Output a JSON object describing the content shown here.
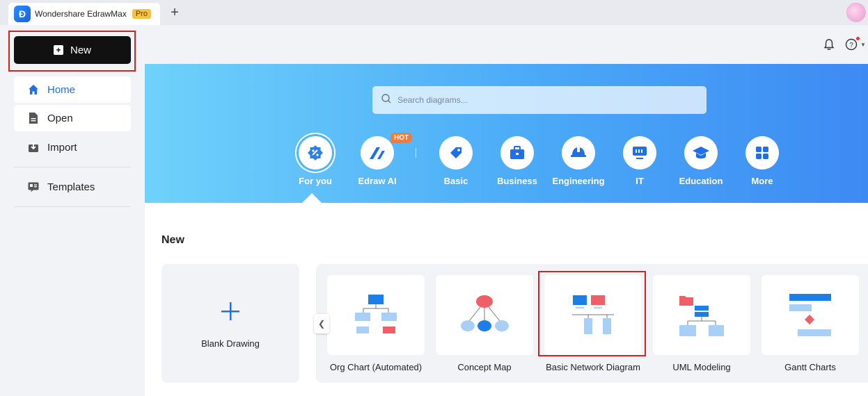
{
  "titlebar": {
    "app_title": "Wondershare EdrawMax",
    "badge": "Pro",
    "logo_glyph": "Đ",
    "add_tab": "+"
  },
  "sidebar": {
    "new_label": "New",
    "items": [
      {
        "label": "Home",
        "icon": "home-icon"
      },
      {
        "label": "Open",
        "icon": "file-icon"
      },
      {
        "label": "Import",
        "icon": "import-icon"
      },
      {
        "label": "Templates",
        "icon": "templates-icon"
      }
    ]
  },
  "search": {
    "placeholder": "Search diagrams..."
  },
  "categories": [
    {
      "label": "For you",
      "icon": "for-you-icon",
      "active": true
    },
    {
      "label": "Edraw AI",
      "icon": "edraw-ai-icon",
      "badge": "HOT"
    },
    {
      "label": "Basic",
      "icon": "basic-tag-icon"
    },
    {
      "label": "Business",
      "icon": "briefcase-icon"
    },
    {
      "label": "Engineering",
      "icon": "hardhat-icon"
    },
    {
      "label": "IT",
      "icon": "monitor-icon"
    },
    {
      "label": "Education",
      "icon": "graduation-cap-icon"
    },
    {
      "label": "More",
      "icon": "grid-icon"
    }
  ],
  "main": {
    "section_title": "New",
    "blank_label": "Blank Drawing",
    "templates": [
      {
        "label": "Org Chart (Automated)"
      },
      {
        "label": "Concept Map"
      },
      {
        "label": "Basic Network Diagram",
        "selected": true
      },
      {
        "label": "UML Modeling"
      },
      {
        "label": "Gantt Charts"
      }
    ]
  },
  "colors": {
    "accent": "#1f6fe5",
    "highlight": "#d92121",
    "hot": "#f47a3a"
  }
}
